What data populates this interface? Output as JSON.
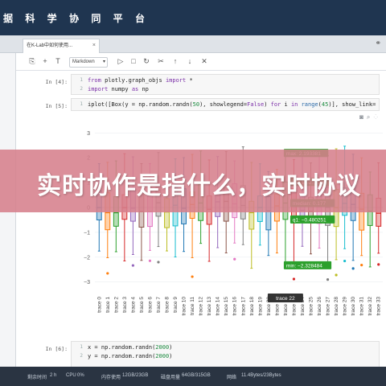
{
  "platform": {
    "title": "据 科 学 协 同 平 台"
  },
  "tab": {
    "label": "在K-Lab中如何使用...",
    "close": "×"
  },
  "tab_strip_right": "⚭",
  "toolbar": {
    "cell_type": "Markdown"
  },
  "cells": [
    {
      "prompt": "In [4]:",
      "lines": [
        {
          "n": "1",
          "text": "from plotly.graph_objs import *"
        },
        {
          "n": "2",
          "text": "import numpy as np"
        }
      ]
    },
    {
      "prompt": "In [5]:",
      "lines": [
        {
          "n": "1",
          "text": "iplot([Box(y = np.random.randn(50), showlegend=False) for i in range(45)], show_link="
        }
      ]
    },
    {
      "prompt": "In [6]:",
      "lines": [
        {
          "n": "1",
          "text": "x = np.random.randn(2000)"
        },
        {
          "n": "2",
          "text": "y = np.random.randn(2000)"
        }
      ]
    }
  ],
  "status_bar": {
    "runtime_label": "剩余时间",
    "runtime": "2 h",
    "cpu_label": "CPU",
    "cpu": "0%",
    "mem_label": "内存使用",
    "mem": "12GB/23GB",
    "disk_label": "磁盘用量",
    "disk": "64GB/315GB",
    "net_label": "网络",
    "net": "11.4Bytes/23Bytes"
  },
  "banner": {
    "text": "实时协作是指什么，实时协议"
  },
  "chart_data": {
    "type": "box",
    "ylim": [
      -3.4,
      3.4
    ],
    "yticks": [
      "−3",
      "−2",
      "−1",
      "0",
      "1",
      "2",
      "3"
    ],
    "ytick_values": [
      -3,
      -2,
      -1,
      0,
      1,
      2,
      3
    ],
    "categories": [
      "trace 0",
      "trace 1",
      "trace 2",
      "trace 3",
      "trace 4",
      "trace 5",
      "trace 6",
      "trace 7",
      "trace 8",
      "trace 9",
      "trace 10",
      "trace 11",
      "trace 12",
      "trace 13",
      "trace 14",
      "trace 15",
      "trace 16",
      "trace 17",
      "trace 18",
      "trace 19",
      "trace 20",
      "trace 21",
      "trace 22",
      "trace 23",
      "trace 24",
      "trace 25",
      "trace 26",
      "trace 27",
      "trace 28",
      "trace 29",
      "trace 30",
      "trace 31",
      "trace 32",
      "trace 33"
    ],
    "colors": [
      "#1f77b4",
      "#ff7f0e",
      "#2ca02c",
      "#d62728",
      "#9467bd",
      "#8c564b",
      "#e377c2",
      "#7f7f7f",
      "#bcbd22",
      "#17becf"
    ],
    "hover": {
      "trace": "trace 22",
      "labels": [
        {
          "text": "max: 2.193381",
          "value": 2.193381
        },
        {
          "text": "q3: 1.027759",
          "value": 1.027759
        },
        {
          "text": "median: 0.177",
          "value": 0.177
        },
        {
          "text": "q1: −0.480251",
          "value": -0.480251
        },
        {
          "text": "min: −2.328484",
          "value": -2.328484
        }
      ]
    }
  }
}
